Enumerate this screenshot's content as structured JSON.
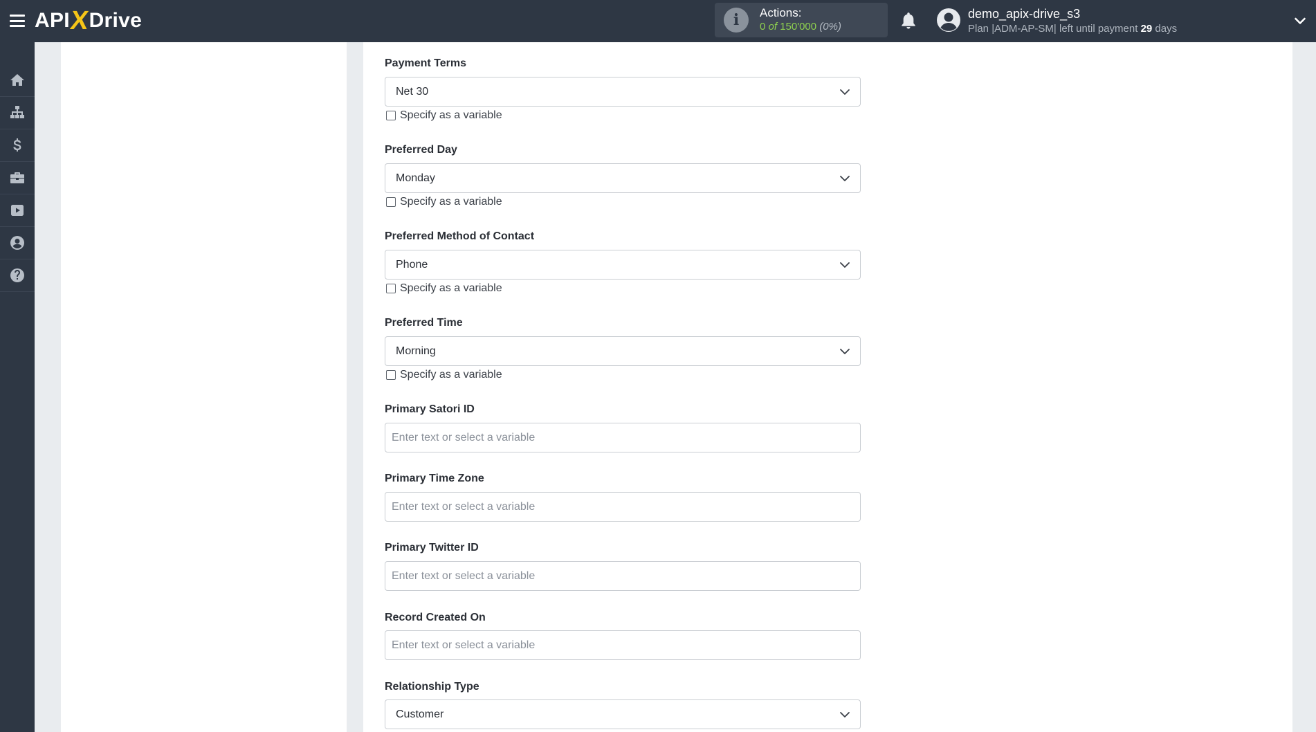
{
  "header": {
    "logo": {
      "left": "API",
      "x": "X",
      "right": "Drive"
    },
    "actions": {
      "label": "Actions:",
      "used": "0",
      "of": "of",
      "total": "150'000",
      "percent": "(0%)"
    },
    "user": {
      "name": "demo_apix-drive_s3",
      "plan_prefix": "Plan |ADM-AP-SM| left until payment",
      "days_count": "29",
      "days_suffix": "days"
    }
  },
  "sidebar": {
    "items": [
      {
        "name": "home-icon"
      },
      {
        "name": "sitemap-icon"
      },
      {
        "name": "dollar-icon"
      },
      {
        "name": "briefcase-icon"
      },
      {
        "name": "youtube-icon"
      },
      {
        "name": "user-circle-icon"
      },
      {
        "name": "help-icon"
      }
    ]
  },
  "form": {
    "variable_checkbox_label": "Specify as a variable",
    "input_placeholder": "Enter text or select a variable",
    "fields": [
      {
        "label": "Payment Terms",
        "type": "select",
        "value": "Net 30"
      },
      {
        "label": "Preferred Day",
        "type": "select",
        "value": "Monday"
      },
      {
        "label": "Preferred Method of Contact",
        "type": "select",
        "value": "Phone"
      },
      {
        "label": "Preferred Time",
        "type": "select",
        "value": "Morning"
      },
      {
        "label": "Primary Satori ID",
        "type": "text",
        "value": ""
      },
      {
        "label": "Primary Time Zone",
        "type": "text",
        "value": ""
      },
      {
        "label": "Primary Twitter ID",
        "type": "text",
        "value": ""
      },
      {
        "label": "Record Created On",
        "type": "text",
        "value": ""
      },
      {
        "label": "Relationship Type",
        "type": "select",
        "value": "Customer"
      }
    ]
  },
  "colors": {
    "topbar": "#2e3744",
    "accent_yellow": "#f5c518",
    "actions_green": "#8fd14f"
  }
}
